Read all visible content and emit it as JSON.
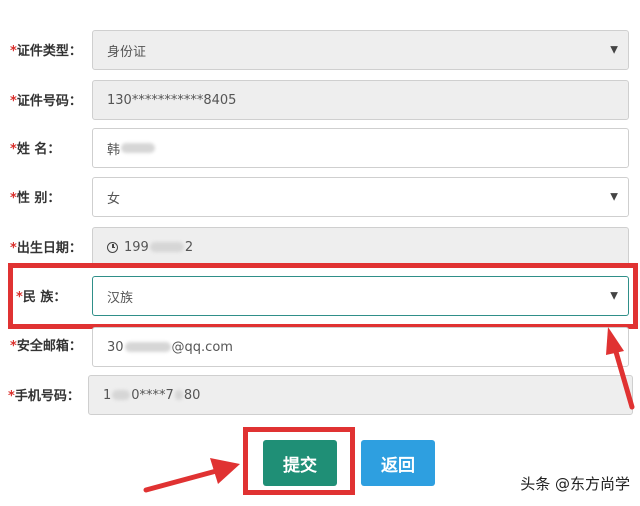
{
  "form": {
    "id_type": {
      "label": "证件类型：",
      "value": "身份证"
    },
    "id_number": {
      "label": "证件号码：",
      "value": "130***********8405"
    },
    "name": {
      "label": "姓 名：",
      "value_prefix": "韩"
    },
    "gender": {
      "label": "性 别：",
      "value": "女"
    },
    "birth_date": {
      "label": "出生日期：",
      "value_prefix": "199",
      "value_suffix": "2"
    },
    "ethnicity": {
      "label": "民 族：",
      "value": "汉族"
    },
    "email": {
      "label": "安全邮箱：",
      "value_prefix": "30",
      "value_suffix": "@qq.com"
    },
    "phone": {
      "label": "手机号码：",
      "value_prefix": "1",
      "value_mid": "0****7",
      "value_suffix": "80"
    },
    "required_mark": "*"
  },
  "buttons": {
    "submit": "提交",
    "back": "返回"
  },
  "watermark": "头条 @东方尚学",
  "colors": {
    "highlight": "#e03232",
    "submit": "#1f8f76",
    "back": "#2e9fe0"
  }
}
